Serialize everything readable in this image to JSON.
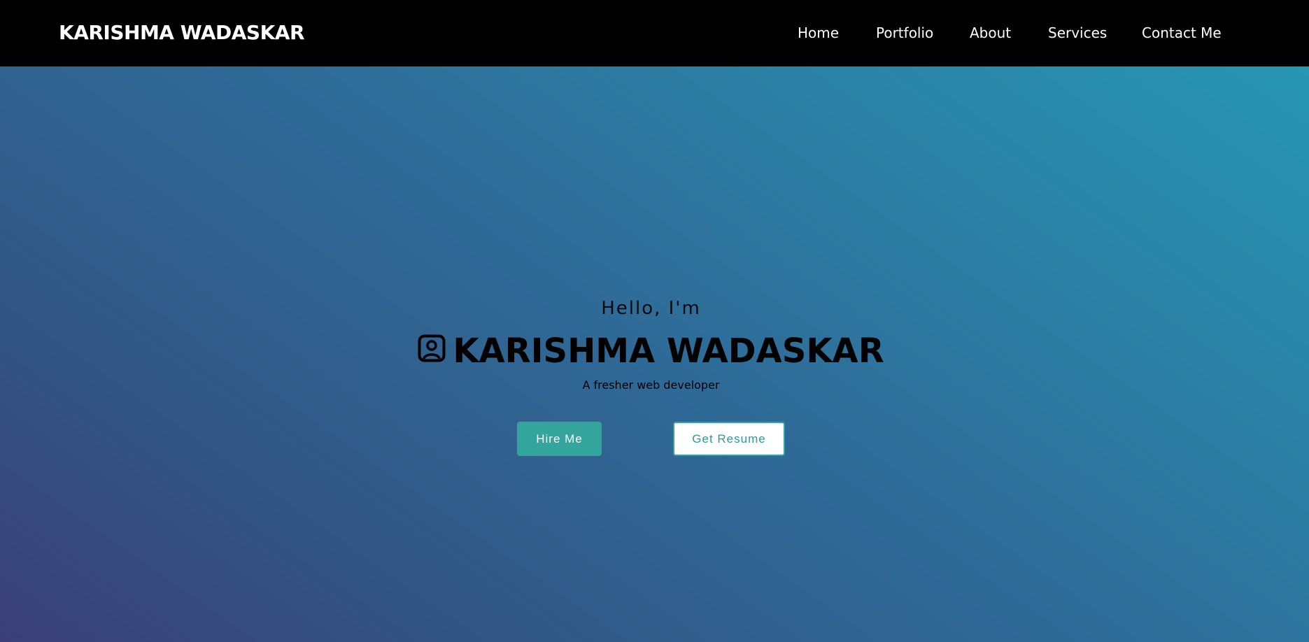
{
  "navbar": {
    "brand": "KARISHMA WADASKAR",
    "links": [
      {
        "label": "Home"
      },
      {
        "label": "Portfolio"
      },
      {
        "label": "About"
      },
      {
        "label": "Services"
      },
      {
        "label": "Contact Me"
      }
    ],
    "background": "#000000",
    "text_color": "#ffffff"
  },
  "hero": {
    "greeting": "Hello, I'm",
    "name": "KARISHMA WADASKAR",
    "name_icon": "person-badge-icon",
    "tagline": "A fresher web developer",
    "hire_button": "Hire Me",
    "resume_button": "Get Resume",
    "accent_color": "#33a59c",
    "gradient": [
      "#3b3e79",
      "#2f6a97",
      "#2696b2"
    ]
  }
}
